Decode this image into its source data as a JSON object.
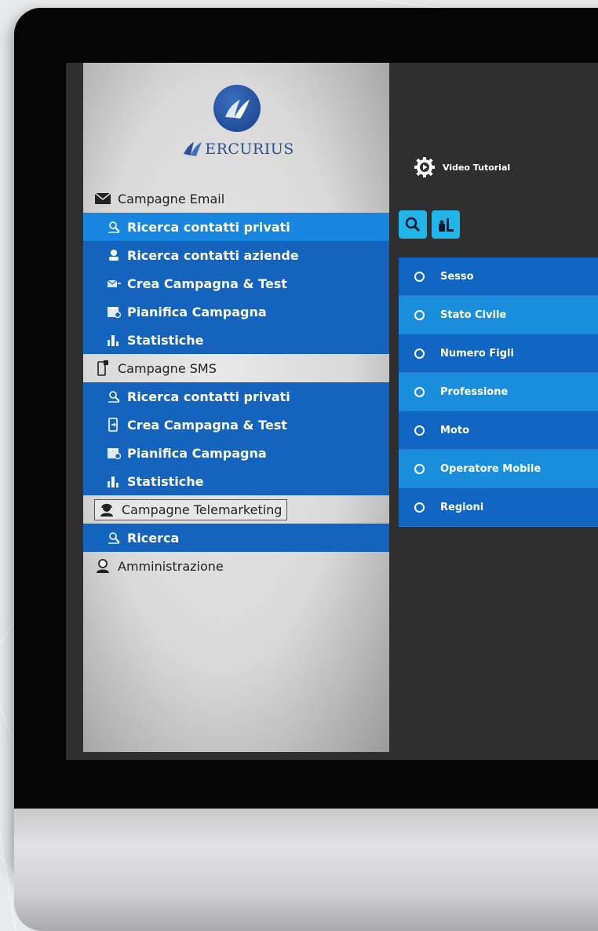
{
  "colors": {
    "sidebar_item_blue": "#1464bd",
    "sidebar_item_active": "#1886de",
    "filter_dark": "#1165c3",
    "filter_light": "#1b8ddd",
    "tool_button": "#22b5ea",
    "screen_bg": "#2f2f2f"
  },
  "logo": {
    "text": "ERCURIUS",
    "icon": "wing-logo-icon"
  },
  "sidebar": {
    "sections": [
      {
        "label": "Campagne Email",
        "icon": "envelope-icon",
        "items": [
          {
            "label": "Ricerca contatti privati",
            "icon": "person-search-icon",
            "active": true
          },
          {
            "label": "Ricerca contatti aziende",
            "icon": "company-icon"
          },
          {
            "label": "Crea Campagna & Test",
            "icon": "mail-send-icon"
          },
          {
            "label": "Pianifica Campagna",
            "icon": "calendar-icon"
          },
          {
            "label": "Statistiche",
            "icon": "bar-chart-icon"
          }
        ]
      },
      {
        "label": "Campagne SMS",
        "icon": "phone-icon",
        "items": [
          {
            "label": "Ricerca contatti privati",
            "icon": "person-search-icon"
          },
          {
            "label": "Crea Campagna & Test",
            "icon": "phone-sms-icon"
          },
          {
            "label": "Pianifica Campagna",
            "icon": "calendar-icon"
          },
          {
            "label": "Statistiche",
            "icon": "bar-chart-icon"
          }
        ]
      },
      {
        "label": "Campagne Telemarketing",
        "icon": "operator-icon",
        "items": [
          {
            "label": "Ricerca",
            "icon": "person-search-icon"
          }
        ]
      },
      {
        "label": "Amministrazione",
        "icon": "admin-user-icon",
        "items": []
      }
    ]
  },
  "main": {
    "tutorial_label": "Video Tutorial",
    "toolbar": [
      {
        "icon": "search-icon"
      },
      {
        "icon": "database-icon"
      }
    ],
    "filters": [
      "Sesso",
      "Stato Civile",
      "Numero Figli",
      "Professione",
      "Moto",
      "Operatore Mobile",
      "Regioni"
    ]
  }
}
